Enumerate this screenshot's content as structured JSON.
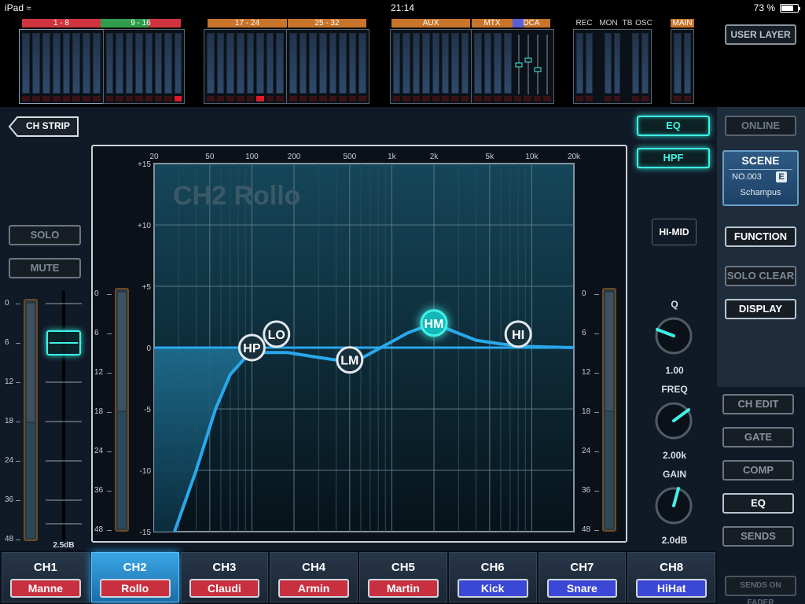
{
  "status": {
    "device": "iPad",
    "time": "21:14",
    "battery": "73 %"
  },
  "meters": {
    "groups": [
      {
        "label": "1 - 8",
        "color": "#d0343e"
      },
      {
        "label": "9 - 16",
        "color": "#2f9d4c"
      },
      {
        "label": "17 - 24",
        "color": "#c8742a"
      },
      {
        "label": "25 - 32",
        "color": "#c8742a"
      },
      {
        "label": "AUX",
        "color": "#c8742a"
      },
      {
        "label": "MTX",
        "color": "#c8742a"
      },
      {
        "label": "DCA",
        "color": "#5a5fd6"
      },
      {
        "label": "REC"
      },
      {
        "label": "MON"
      },
      {
        "label": "TB"
      },
      {
        "label": "OSC"
      },
      {
        "label": "MAIN",
        "color": "#c8742a"
      }
    ],
    "user_layer_label": "USER LAYER"
  },
  "left": {
    "back_label": "CH STRIP",
    "solo_label": "SOLO",
    "mute_label": "MUTE",
    "fader_scale": [
      "0",
      "6",
      "12",
      "18",
      "24",
      "36",
      "48"
    ],
    "fader_value": "2.5dB",
    "fader_level_db": 2.5
  },
  "eq": {
    "channel_title": "CH2  Rollo",
    "freq_labels": [
      "20",
      "50",
      "100",
      "200",
      "500",
      "1k",
      "2k",
      "5k",
      "10k",
      "20k"
    ],
    "gain_labels": [
      "+15",
      "+10",
      "+5",
      "0",
      "-5",
      "-10",
      "-15"
    ],
    "meter_scale": [
      "0",
      "6",
      "12",
      "18",
      "24",
      "36",
      "48"
    ],
    "bands": [
      {
        "id": "HP",
        "label": "HP"
      },
      {
        "id": "LO",
        "label": "LO"
      },
      {
        "id": "LM",
        "label": "LM"
      },
      {
        "id": "HM",
        "label": "HM",
        "selected": true
      },
      {
        "id": "HI",
        "label": "HI"
      }
    ],
    "eq_button": "EQ",
    "hpf_button": "HPF",
    "band_name": "HI-MID",
    "q_label": "Q",
    "q_value": "1.00",
    "freq_label": "FREQ",
    "freq_value": "2.00k",
    "gain_label": "GAIN",
    "gain_value": "2.0dB"
  },
  "right": {
    "online": "ONLINE",
    "scene_title": "SCENE",
    "scene_no": "NO.003",
    "scene_badge": "E",
    "scene_name": "Schampus",
    "function": "FUNCTION",
    "solo_clear": "SOLO CLEAR",
    "display": "DISPLAY",
    "ch_edit": "CH EDIT",
    "gate": "GATE",
    "comp": "COMP",
    "eq": "EQ",
    "sends": "SENDS",
    "sends_on_fader": "SENDS ON FADER"
  },
  "channels": [
    {
      "id": "CH1",
      "name": "Manne",
      "color": "#c9303f"
    },
    {
      "id": "CH2",
      "name": "Rollo",
      "color": "#c9303f",
      "selected": true
    },
    {
      "id": "CH3",
      "name": "Claudi",
      "color": "#c9303f"
    },
    {
      "id": "CH4",
      "name": "Armin",
      "color": "#c9303f"
    },
    {
      "id": "CH5",
      "name": "Martin",
      "color": "#c9303f"
    },
    {
      "id": "CH6",
      "name": "Kick",
      "color": "#3b48d6"
    },
    {
      "id": "CH7",
      "name": "Snare",
      "color": "#3b48d6"
    },
    {
      "id": "CH8",
      "name": "HiHat",
      "color": "#3b48d6"
    }
  ],
  "colors": {
    "accent": "#40f2e6",
    "curve": "#29a8ec",
    "graph_bg": "#0e2a38"
  }
}
